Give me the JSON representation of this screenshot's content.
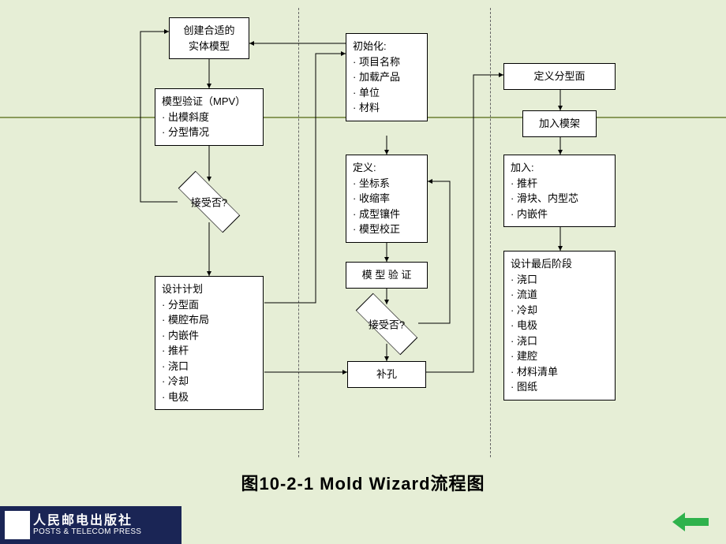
{
  "caption": "图10-2-1  Mold Wizard流程图",
  "publisher": {
    "cn": "人民邮电出版社",
    "en": "POSTS & TELECOM PRESS"
  },
  "col1": {
    "create_model": "创建合适的\n实体模型",
    "model_verify": {
      "title": "模型验证（MPV）",
      "items": [
        "出模斜度",
        "分型情况"
      ]
    },
    "accept": "接受否?",
    "design_plan": {
      "title": "设计计划",
      "items": [
        "分型面",
        "模腔布局",
        "内嵌件",
        "推杆",
        "浇口",
        "冷却",
        "电极"
      ]
    }
  },
  "col2": {
    "init": {
      "title": "初始化:",
      "items": [
        "项目名称",
        "加载产品",
        "单位",
        "材料"
      ]
    },
    "define": {
      "title": "定义:",
      "items": [
        "坐标系",
        "收缩率",
        "成型镶件",
        "模型校正"
      ]
    },
    "verify": "模 型 验 证",
    "accept": "接受否?",
    "patch": "补孔"
  },
  "col3": {
    "parting": "定义分型面",
    "moldbase": "加入模架",
    "add": {
      "title": "加入:",
      "items": [
        "推杆",
        "滑块、内型芯",
        "内嵌件"
      ]
    },
    "final": {
      "title": "设计最后阶段",
      "items": [
        "浇口",
        "流道",
        "冷却",
        "电极",
        "浇口",
        "建腔",
        "材料清单",
        "图纸"
      ]
    }
  }
}
